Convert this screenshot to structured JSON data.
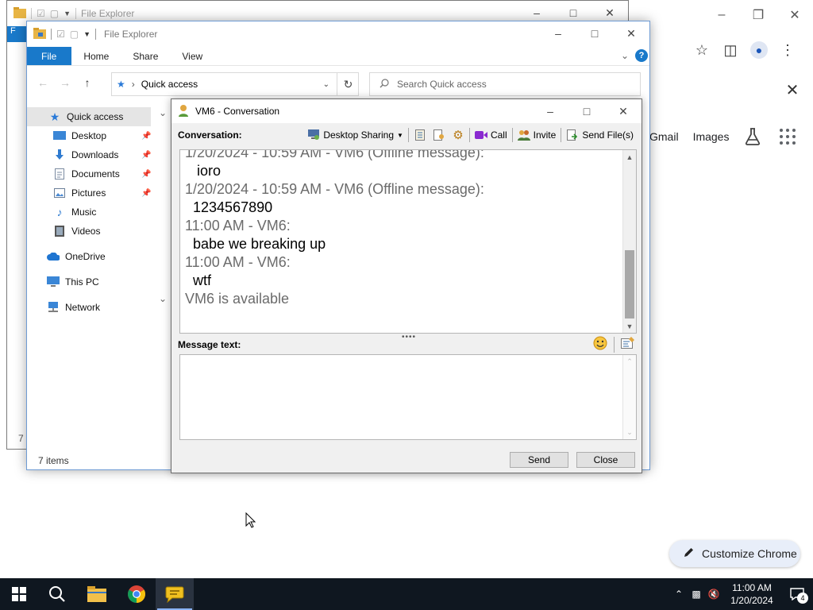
{
  "back_explorer": {
    "title": "File Explorer",
    "ribbon_tab": "F",
    "status": "7 i"
  },
  "explorer": {
    "title": "File Explorer",
    "tabs": [
      "File",
      "Home",
      "Share",
      "View"
    ],
    "address": "Quick access",
    "search_placeholder": "Search Quick access",
    "sidebar": {
      "quick_access": "Quick access",
      "pinned": [
        {
          "label": "Desktop",
          "icon": "desktop-icon"
        },
        {
          "label": "Downloads",
          "icon": "downloads-icon"
        },
        {
          "label": "Documents",
          "icon": "documents-icon"
        },
        {
          "label": "Pictures",
          "icon": "pictures-icon"
        }
      ],
      "unpinned": [
        {
          "label": "Music",
          "icon": "music-icon"
        },
        {
          "label": "Videos",
          "icon": "videos-icon"
        }
      ],
      "onedrive": "OneDrive",
      "this_pc": "This PC",
      "network": "Network"
    },
    "status": "7 items"
  },
  "conversation": {
    "title": "VM6 - Conversation",
    "conversation_label": "Conversation:",
    "tools": {
      "desktop_sharing": "Desktop Sharing",
      "call": "Call",
      "invite": "Invite",
      "send_files": "Send File(s)"
    },
    "history": [
      {
        "header": "1/20/2024 - 10:59 AM - VM6 (Offline message):",
        "text": "ioro"
      },
      {
        "header": "1/20/2024 - 10:59 AM - VM6 (Offline message):",
        "text": "1234567890"
      },
      {
        "header": "11:00 AM - VM6:",
        "text": "babe we breaking up"
      },
      {
        "header": "11:00 AM - VM6:",
        "text": "wtf"
      }
    ],
    "status_line": "VM6 is available",
    "message_label": "Message text:",
    "message_value": "",
    "send": "Send",
    "close": "Close"
  },
  "chrome": {
    "links": [
      "Gmail",
      "Images"
    ],
    "customize": "Customize Chrome"
  },
  "taskbar": {
    "time": "11:00 AM",
    "date": "1/20/2024",
    "notifications": "4"
  },
  "colors": {
    "accent": "#1979ca",
    "taskbar": "#0f1720",
    "history_header": "#6b6b6b"
  }
}
